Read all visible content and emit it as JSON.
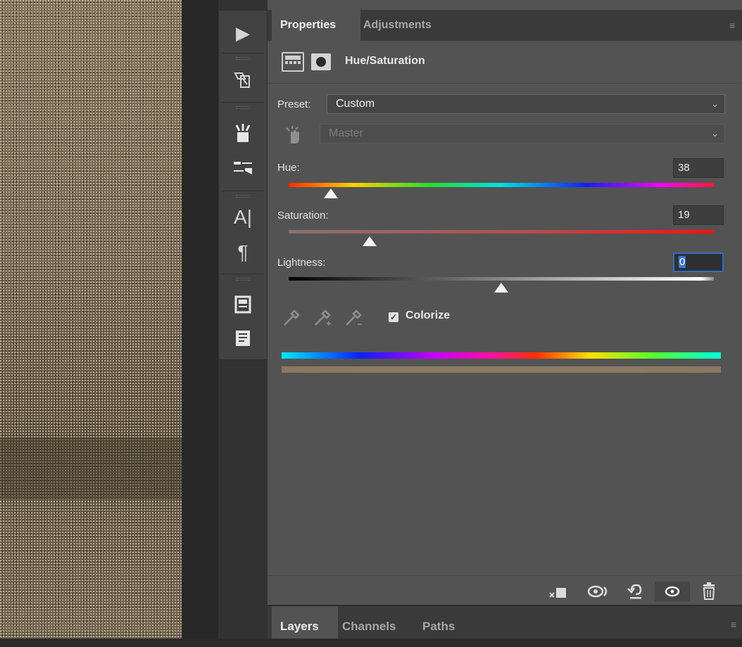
{
  "tabs": {
    "properties": "Properties",
    "adjustments": "Adjustments"
  },
  "panel": {
    "title": "Hue/Saturation"
  },
  "preset": {
    "label": "Preset:",
    "value": "Custom"
  },
  "channel": {
    "value": "Master"
  },
  "hue": {
    "label": "Hue:",
    "value": "38",
    "level": 0.1
  },
  "saturation": {
    "label": "Saturation:",
    "value": "19",
    "level": 0.19
  },
  "lightness": {
    "label": "Lightness:",
    "value": "0",
    "level": 0.5
  },
  "colorize": {
    "label": "Colorize",
    "checked": true
  },
  "colors": {
    "result_swatch": "#8d7b63",
    "panel_bg": "#535353",
    "selection_blue": "#3b74d8"
  },
  "layers_tabs": {
    "layers": "Layers",
    "channels": "Channels",
    "paths": "Paths"
  },
  "icons": {
    "tool_strip": [
      "play-icon",
      "3d-transform-icon",
      "brush-presets-icon",
      "adjustments-icon",
      "character-icon",
      "paragraph-icon",
      "notes-icon",
      "text-doc-icon"
    ],
    "bottom_toolbar": [
      "clip-to-layer-icon",
      "view-previous-icon",
      "reset-icon",
      "visibility-icon",
      "trash-icon"
    ],
    "eyedroppers": [
      "eyedropper-icon",
      "eyedropper-plus-icon",
      "eyedropper-minus-icon"
    ]
  }
}
